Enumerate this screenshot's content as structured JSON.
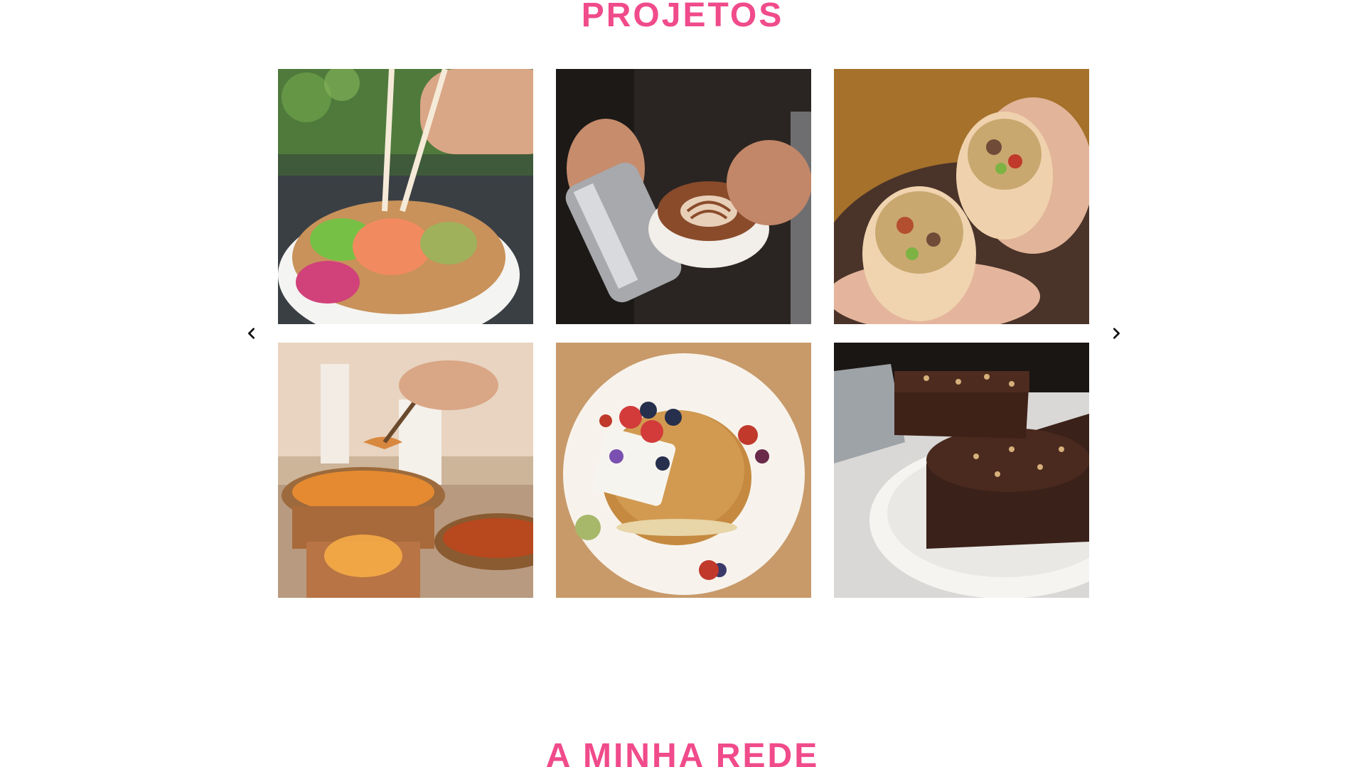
{
  "sections": {
    "projects_title": "PROJETOS",
    "network_title": "A MINHA REDE"
  },
  "gallery": {
    "items": [
      {
        "subject": "poke bowl with chopsticks"
      },
      {
        "subject": "latte art being poured"
      },
      {
        "subject": "burrito halves held in hands"
      },
      {
        "subject": "curry dishes in copper pots"
      },
      {
        "subject": "pancake stack with berries"
      },
      {
        "subject": "chocolate cake slice"
      }
    ],
    "prev_icon": "chevron-left-icon",
    "next_icon": "chevron-right-icon"
  },
  "colors": {
    "accent": "#f04b8b",
    "background": "#ffffff",
    "arrow": "#111111"
  }
}
